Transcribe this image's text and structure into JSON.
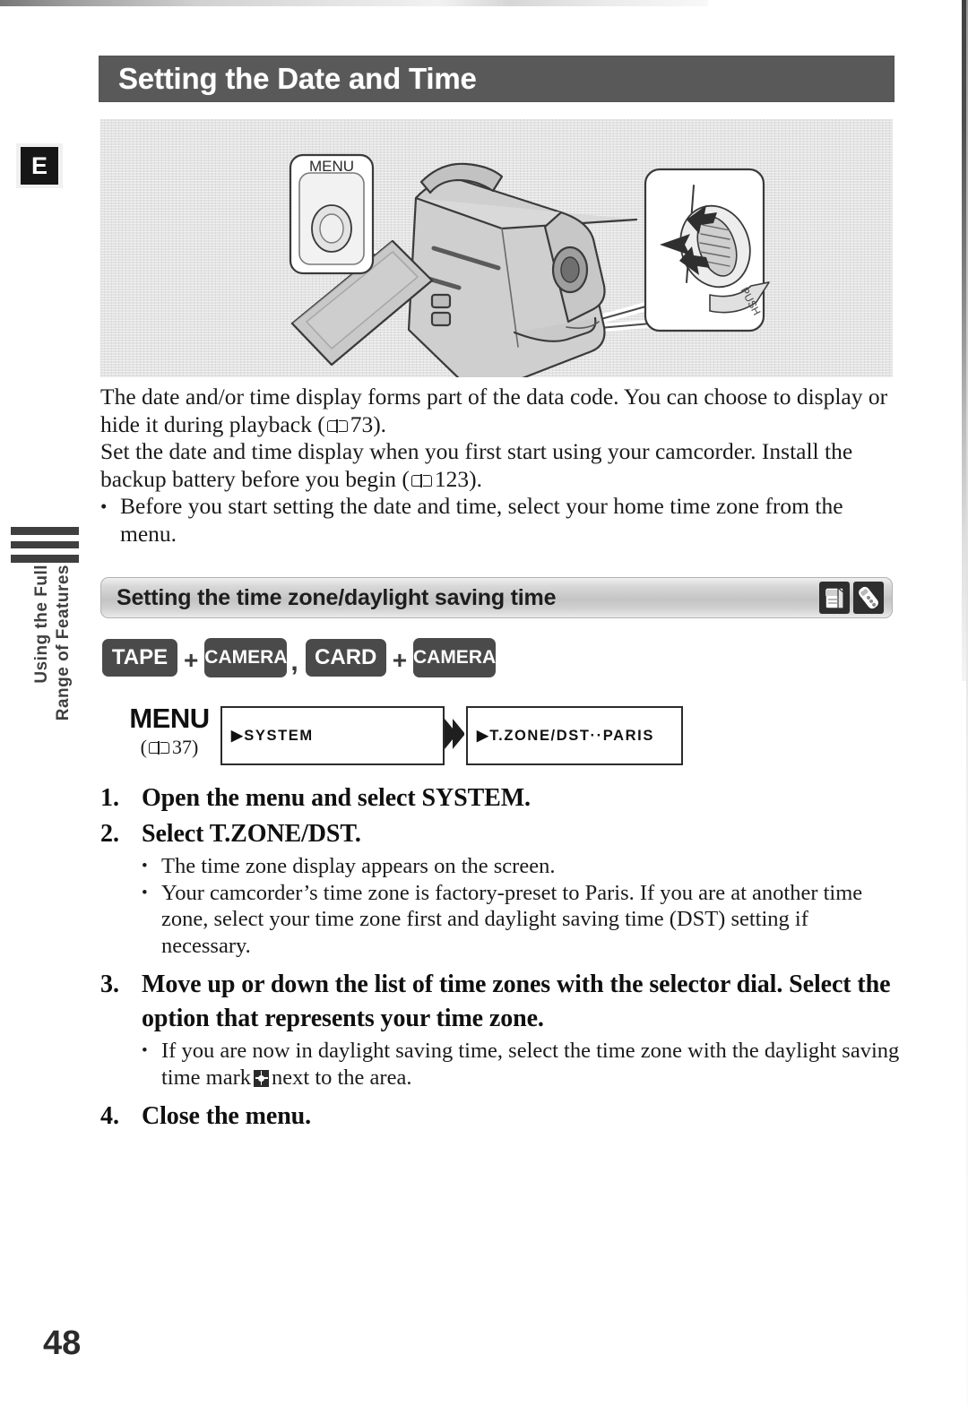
{
  "margin": {
    "language_badge": "E",
    "tab_line1": "Using the Full",
    "tab_line2": "Range of Features"
  },
  "header": {
    "title": "Setting the Date and Time"
  },
  "illustration": {
    "menu_button_label": "MENU",
    "dial_push_label": "PUSH",
    "alt": "Camcorder with LCD panel open, MENU button callout and selector dial callout"
  },
  "intro": {
    "para1_a": "The date and/or time display forms part of the data code. You can choose to display or hide it during playback (",
    "para1_ref": "73",
    "para1_b": ").",
    "para2_a": "Set the date and time display when you first start using your camcorder. Install the backup battery before you begin (",
    "para2_ref": "123",
    "para2_b": ").",
    "bullet_dot": "•",
    "bullet1": "Before you start setting the date and time, select your home time zone from the menu."
  },
  "subsection": {
    "title": "Setting the time zone/daylight saving time",
    "icon1": "memory-card-icon",
    "icon2": "remote-control-icon"
  },
  "modes": {
    "tape": "TAPE",
    "camera1": "CAMERA",
    "card": "CARD",
    "camera2": "CAMERA",
    "plus1": "+",
    "plus2": "+",
    "separator": ","
  },
  "menu_nav": {
    "label": "MENU",
    "ref_open": "(",
    "ref_page": "37",
    "ref_close": ")",
    "screen1": "▶SYSTEM",
    "screen2": "▶T.ZONE/DST··PARIS",
    "arrow": "double-chevron-right-icon"
  },
  "steps": [
    {
      "num": "1.",
      "title": "Open the menu and select SYSTEM.",
      "bullets": []
    },
    {
      "num": "2.",
      "title": "Select T.ZONE/DST.",
      "bullets": [
        "The time zone display appears on the screen.",
        "Your camcorder’s time zone is factory-preset to Paris. If you are at another time zone, select your time zone first and daylight saving time (DST) setting if necessary."
      ]
    },
    {
      "num": "3.",
      "title": "Move up or down the list of time zones with the selector dial. Select the option that represents your time zone.",
      "bullets": [],
      "bullet_dst_a": "If you are now in daylight saving time, select the time zone with the daylight saving time mark",
      "bullet_dst_b": "next to the area."
    },
    {
      "num": "4.",
      "title": "Close the menu.",
      "bullets": []
    }
  ],
  "footer": {
    "page_number": "48"
  },
  "colors": {
    "title_bar_bg": "#595959",
    "subsection_bg": "#c4c4c4",
    "chip_bg": "#4a4a4a",
    "illustration_bg": "#dedede",
    "text": "#1b1b1b"
  }
}
